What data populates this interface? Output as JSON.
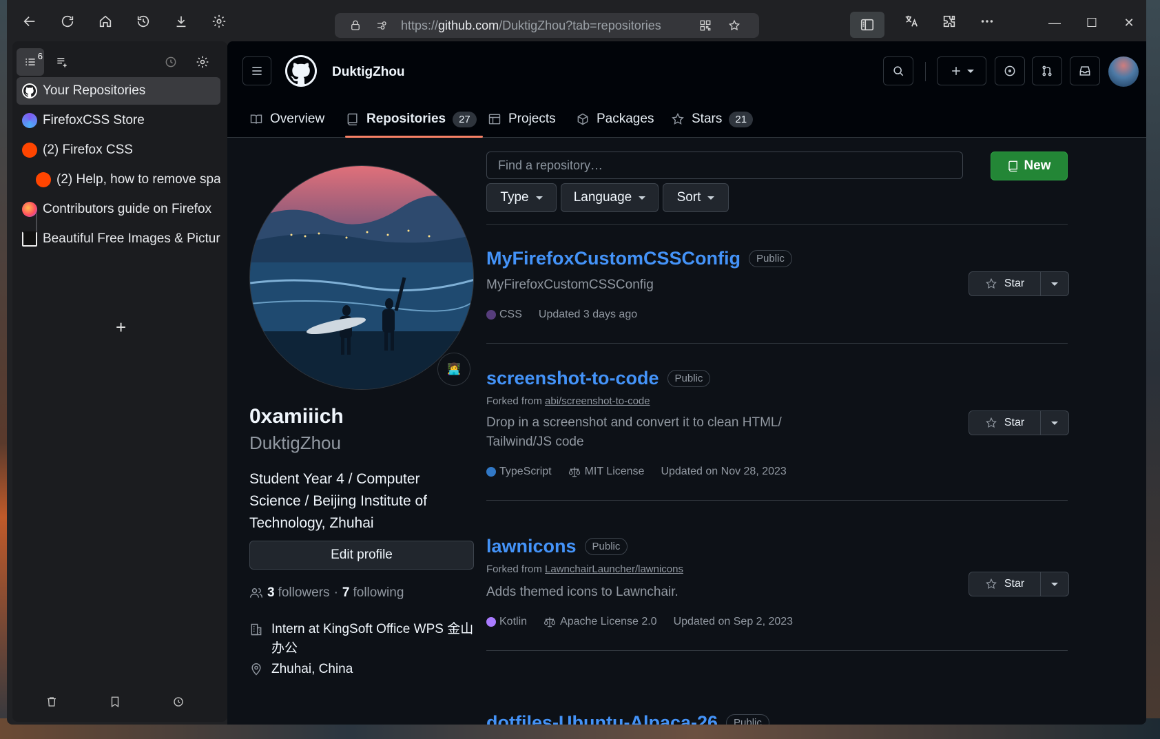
{
  "browser": {
    "url_prefix": "https://",
    "url_host": "github.com",
    "url_path": "/DuktigZhou?tab=repositories"
  },
  "sidebar": {
    "tab_count_badge": "6",
    "tabs": [
      {
        "label": "Your Repositories",
        "favicon": "github-icon",
        "active": true
      },
      {
        "label": "FirefoxCSS Store",
        "favicon": "firefoxcss-store-icon"
      },
      {
        "label": "(2) Firefox CSS",
        "favicon": "reddit-icon"
      },
      {
        "label": "(2) Help, how to remove spa",
        "favicon": "reddit-icon",
        "child": true
      },
      {
        "label": "Contributors guide on Firefox",
        "favicon": "firefox-icon"
      },
      {
        "label": "Beautiful Free Images & Pictur",
        "favicon": "unsplash-icon"
      }
    ],
    "add_label": "+"
  },
  "github": {
    "username": "DuktigZhou",
    "tabs": [
      {
        "label": "Overview"
      },
      {
        "label": "Repositories",
        "count": "27",
        "active": true
      },
      {
        "label": "Projects"
      },
      {
        "label": "Packages"
      },
      {
        "label": "Stars",
        "count": "21"
      }
    ],
    "profile": {
      "name": "0xamiiich",
      "login": "DuktigZhou",
      "bio": "Student Year 4 / Computer Science / Beijing Institute of Technology, Zhuhai",
      "edit_label": "Edit profile",
      "followers_count": "3",
      "followers_label": "followers",
      "separator": "·",
      "following_count": "7",
      "following_label": "following",
      "company": "Intern at KingSoft Office WPS 金山办公",
      "location": "Zhuhai, China"
    },
    "find_placeholder": "Find a repository…",
    "new_label": "New",
    "filters": {
      "type": "Type",
      "language": "Language",
      "sort": "Sort"
    },
    "star_label": "Star",
    "repos": [
      {
        "name": "MyFirefoxCustomCSSConfig",
        "visibility": "Public",
        "description": "MyFirefoxCustomCSSConfig",
        "language": "CSS",
        "language_color": "#563d7c",
        "updated": "Updated 3 days ago"
      },
      {
        "name": "screenshot-to-code",
        "visibility": "Public",
        "forked_prefix": "Forked from",
        "forked_from": "abi/screenshot-to-code",
        "description": "Drop in a screenshot and convert it to clean HTML/ Tailwind/JS code",
        "language": "TypeScript",
        "language_color": "#3178c6",
        "license": "MIT License",
        "updated": "Updated on Nov 28, 2023"
      },
      {
        "name": "lawnicons",
        "visibility": "Public",
        "forked_prefix": "Forked from",
        "forked_from": "LawnchairLauncher/lawnicons",
        "description": "Adds themed icons to Lawnchair.",
        "language": "Kotlin",
        "language_color": "#A97BFF",
        "license": "Apache License 2.0",
        "updated": "Updated on Sep 2, 2023"
      },
      {
        "name": "dotfiles-Ubuntu-Alpaca-26",
        "visibility": "Public"
      }
    ]
  }
}
